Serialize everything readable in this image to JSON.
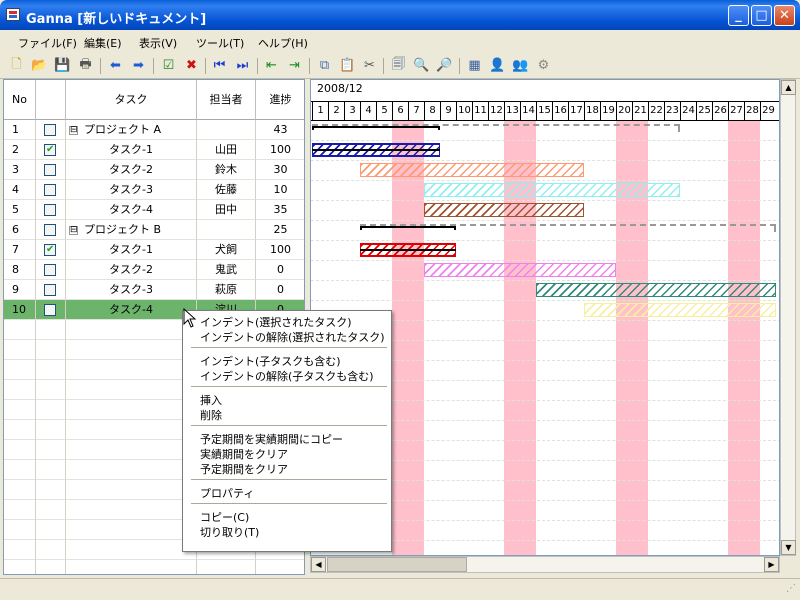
{
  "window": {
    "title": "Ganna [新しいドキュメント]",
    "minimize": "_",
    "maximize": "□",
    "close": "✕"
  },
  "menu": [
    "ファイル(F)",
    "編集(E)",
    "表示(V)",
    "ツール(T)",
    "ヘルプ(H)"
  ],
  "toolbar": [
    "new-icon",
    "open-icon",
    "save-icon",
    "print-icon",
    "arrow-left-icon",
    "arrow-right-icon",
    "checklist-icon",
    "delete-icon",
    "first-icon",
    "last-icon",
    "indent-left-icon",
    "indent-right-icon",
    "copy-icon",
    "paste-icon",
    "cut-icon",
    "pages-icon",
    "zoom-in-icon",
    "zoom-out-icon",
    "table-icon",
    "user-icon",
    "users-icon",
    "settings-icon"
  ],
  "grid": {
    "headers": {
      "no": "No",
      "task": "タスク",
      "owner": "担当者",
      "progress": "進捗"
    },
    "rows": [
      {
        "no": "1",
        "check": false,
        "group": true,
        "task": "プロジェクト A",
        "owner": "",
        "progress": "43",
        "toggle": "⊟"
      },
      {
        "no": "2",
        "check": true,
        "task": "タスク-1",
        "owner": "山田",
        "progress": "100"
      },
      {
        "no": "3",
        "check": false,
        "task": "タスク-2",
        "owner": "鈴木",
        "progress": "30"
      },
      {
        "no": "4",
        "check": false,
        "task": "タスク-3",
        "owner": "佐藤",
        "progress": "10"
      },
      {
        "no": "5",
        "check": false,
        "task": "タスク-4",
        "owner": "田中",
        "progress": "35"
      },
      {
        "no": "6",
        "check": false,
        "group": true,
        "task": "プロジェクト B",
        "owner": "",
        "progress": "25",
        "toggle": "⊟"
      },
      {
        "no": "7",
        "check": true,
        "task": "タスク-1",
        "owner": "犬飼",
        "progress": "100"
      },
      {
        "no": "8",
        "check": false,
        "task": "タスク-2",
        "owner": "鬼武",
        "progress": "0"
      },
      {
        "no": "9",
        "check": false,
        "task": "タスク-3",
        "owner": "萩原",
        "progress": "0"
      },
      {
        "no": "10",
        "check": false,
        "task": "タスク-4",
        "owner": "淀川",
        "progress": "0",
        "selected": true
      }
    ]
  },
  "gantt": {
    "month": "2008/12",
    "days": [
      "1",
      "2",
      "3",
      "4",
      "5",
      "6",
      "7",
      "8",
      "9",
      "10",
      "11",
      "12",
      "13",
      "14",
      "15",
      "16",
      "17",
      "18",
      "19",
      "20",
      "21",
      "22",
      "23",
      "24",
      "25",
      "26",
      "27",
      "28",
      "29"
    ],
    "holidays": [
      6,
      7,
      13,
      14,
      20,
      21,
      27,
      28
    ],
    "colors": {
      "holiday": "#ffc0cb"
    },
    "tasks": [
      {
        "row": 1,
        "type": "summary-bracket",
        "start": 1,
        "end": 8
      },
      {
        "row": 1,
        "type": "summary-dashed",
        "start": 1,
        "end": 23
      },
      {
        "row": 2,
        "type": "bar",
        "start": 1,
        "end": 8,
        "color": "#1a1aaa",
        "actual": true
      },
      {
        "row": 3,
        "type": "bar",
        "start": 4,
        "end": 17,
        "color": "#ff9a70"
      },
      {
        "row": 4,
        "type": "bar",
        "start": 8,
        "end": 23,
        "color": "#8ff0f0"
      },
      {
        "row": 5,
        "type": "bar",
        "start": 8,
        "end": 17,
        "color": "#a0522d"
      },
      {
        "row": 6,
        "type": "summary-bracket",
        "start": 4,
        "end": 9
      },
      {
        "row": 6,
        "type": "summary-dashed",
        "start": 4,
        "end": 29
      },
      {
        "row": 7,
        "type": "bar",
        "start": 4,
        "end": 9,
        "color": "#dd0000",
        "actual": true
      },
      {
        "row": 8,
        "type": "bar",
        "start": 8,
        "end": 19,
        "color": "#f080f0"
      },
      {
        "row": 9,
        "type": "bar",
        "start": 15,
        "end": 29,
        "color": "#2e8b7a"
      },
      {
        "row": 10,
        "type": "bar",
        "start": 18,
        "end": 29,
        "color": "#f7f0a0"
      }
    ]
  },
  "context_menu": {
    "groups": [
      [
        "インデント(選択されたタスク)",
        "インデントの解除(選択されたタスク)"
      ],
      [
        "インデント(子タスクも含む)",
        "インデントの解除(子タスクも含む)"
      ],
      [
        "挿入",
        "削除"
      ],
      [
        "予定期間を実績期間にコピー",
        "実績期間をクリア",
        "予定期間をクリア"
      ],
      [
        "プロパティ"
      ],
      [
        "コピー(C)",
        "切り取り(T)"
      ]
    ]
  },
  "colors": {
    "selected_row": "#6cb36c",
    "title_bar": "#0a5fd8"
  }
}
